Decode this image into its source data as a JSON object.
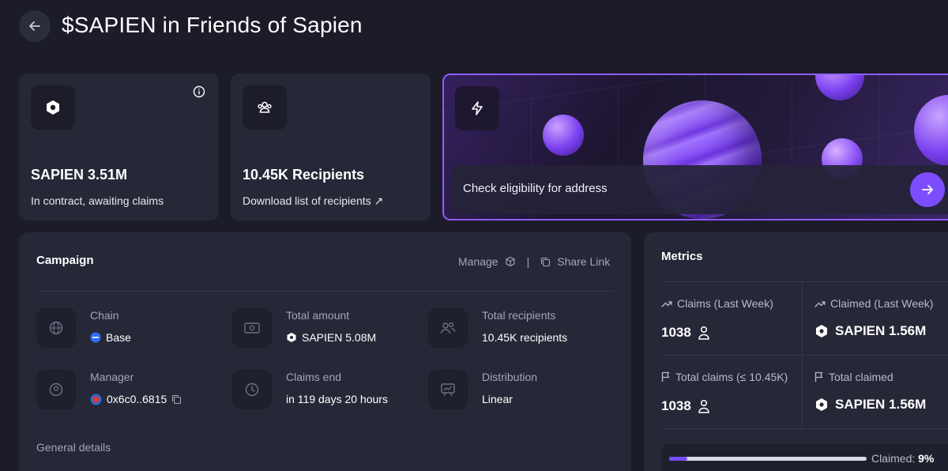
{
  "header": {
    "title": "$SAPIEN in Friends of Sapien",
    "back_icon": "arrow-left-icon"
  },
  "cards": {
    "contract": {
      "amount": "SAPIEN 3.51M",
      "subtitle": "In contract, awaiting claims"
    },
    "recipients": {
      "count": "10.45K Recipients",
      "download": "Download list of recipients ↗"
    },
    "eligibility": {
      "label": "Check eligibility for address"
    }
  },
  "campaign": {
    "title": "Campaign",
    "manage": "Manage",
    "separator": "|",
    "share": "Share Link",
    "chain_label": "Chain",
    "chain_value": "Base",
    "total_amount_label": "Total amount",
    "total_amount_value": "SAPIEN 5.08M",
    "total_recipients_label": "Total recipients",
    "total_recipients_value": "10.45K recipients",
    "manager_label": "Manager",
    "manager_value": "0x6c0..6815",
    "claims_end_label": "Claims end",
    "claims_end_value": "in 119 days 20 hours",
    "distribution_label": "Distribution",
    "distribution_value": "Linear",
    "general_details": "General details"
  },
  "metrics": {
    "title": "Metrics",
    "claims_last_week_label": "Claims (Last Week)",
    "claims_last_week_value": "1038",
    "claimed_last_week_label": "Claimed (Last Week)",
    "claimed_last_week_value": "SAPIEN 1.56M",
    "total_claims_label": "Total claims (≤ 10.45K)",
    "total_claims_value": "1038",
    "total_claimed_label": "Total claimed",
    "total_claimed_value": "SAPIEN 1.56M",
    "claimed_label": "Claimed:",
    "claimed_percent": "9%",
    "claimed_fraction": 0.09
  },
  "colors": {
    "accent": "#7c4dff",
    "background": "#1b1c28",
    "card": "#262837"
  }
}
